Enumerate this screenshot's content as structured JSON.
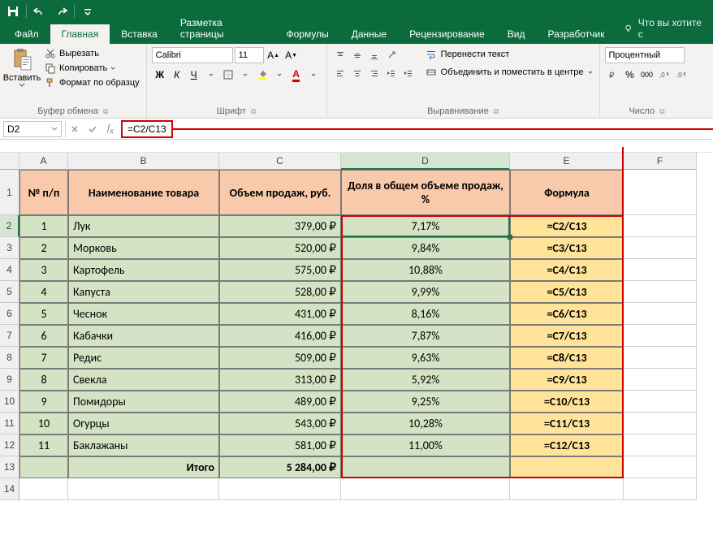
{
  "titlebar": {
    "save": "💾"
  },
  "tabs": {
    "file": "Файл",
    "home": "Главная",
    "insert": "Вставка",
    "pageLayout": "Разметка страницы",
    "formulas": "Формулы",
    "data": "Данные",
    "review": "Рецензирование",
    "view": "Вид",
    "developer": "Разработчик",
    "tellMe": "Что вы хотите с"
  },
  "ribbon": {
    "paste": "Вставить",
    "cut": "Вырезать",
    "copy": "Копировать",
    "formatPainter": "Формат по образцу",
    "clipboard": "Буфер обмена",
    "fontName": "Calibri",
    "fontSize": "11",
    "fontGroup": "Шрифт",
    "wrap": "Перенести текст",
    "merge": "Объединить и поместить в центре",
    "alignGroup": "Выравнивание",
    "numFmt": "Процентный",
    "numGroup": "Число"
  },
  "formulaBar": {
    "nameBox": "D2",
    "formula": "=C2/C13"
  },
  "grid": {
    "cols": [
      "A",
      "B",
      "C",
      "D",
      "E",
      "F"
    ],
    "headers": {
      "A": "№ п/п",
      "B": "Наименование товара",
      "C": "Объем продаж, руб.",
      "D": "Доля в общем объеме продаж, %",
      "E": "Формула"
    },
    "rows": [
      {
        "n": 1,
        "name": "Лук",
        "vol": "379,00 ₽",
        "pct": "7,17%",
        "f": "=C2/C13"
      },
      {
        "n": 2,
        "name": "Морковь",
        "vol": "520,00 ₽",
        "pct": "9,84%",
        "f": "=C3/C13"
      },
      {
        "n": 3,
        "name": "Картофель",
        "vol": "575,00 ₽",
        "pct": "10,88%",
        "f": "=C4/C13"
      },
      {
        "n": 4,
        "name": "Капуста",
        "vol": "528,00 ₽",
        "pct": "9,99%",
        "f": "=C5/C13"
      },
      {
        "n": 5,
        "name": "Чеснок",
        "vol": "431,00 ₽",
        "pct": "8,16%",
        "f": "=C6/C13"
      },
      {
        "n": 6,
        "name": "Кабачки",
        "vol": "416,00 ₽",
        "pct": "7,87%",
        "f": "=C7/C13"
      },
      {
        "n": 7,
        "name": "Редис",
        "vol": "509,00 ₽",
        "pct": "9,63%",
        "f": "=C8/C13"
      },
      {
        "n": 8,
        "name": "Свекла",
        "vol": "313,00 ₽",
        "pct": "5,92%",
        "f": "=C9/C13"
      },
      {
        "n": 9,
        "name": "Помидоры",
        "vol": "489,00 ₽",
        "pct": "9,25%",
        "f": "=C10/C13"
      },
      {
        "n": 10,
        "name": "Огурцы",
        "vol": "543,00 ₽",
        "pct": "10,28%",
        "f": "=C11/C13"
      },
      {
        "n": 11,
        "name": "Баклажаны",
        "vol": "581,00 ₽",
        "pct": "11,00%",
        "f": "=C12/C13"
      }
    ],
    "total": {
      "label": "Итого",
      "vol": "5 284,00 ₽"
    }
  }
}
